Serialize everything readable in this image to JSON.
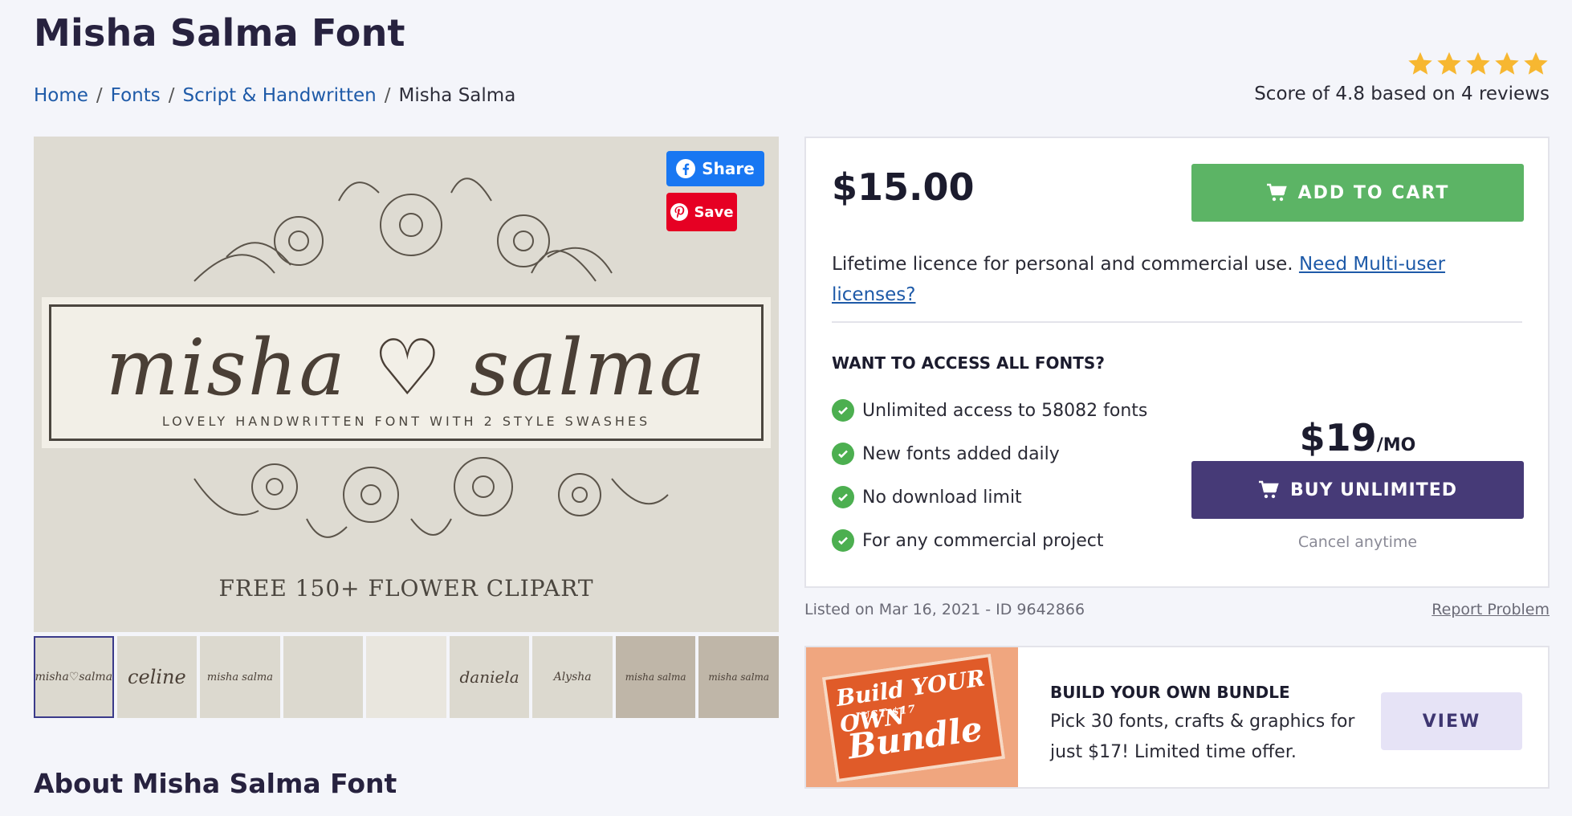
{
  "page": {
    "title": "Misha Salma Font"
  },
  "breadcrumb": [
    {
      "label": "Home"
    },
    {
      "label": "Fonts"
    },
    {
      "label": "Script & Handwritten"
    },
    {
      "label": "Misha Salma"
    }
  ],
  "rating": {
    "stars": 5,
    "text": "Score of 4.8 based on 4 reviews",
    "star_color": "#f7b731"
  },
  "preview": {
    "title_word": "misha ♡ salma",
    "tagline": "LOVELY HANDWRITTEN FONT WITH 2 STYLE SWASHES",
    "clipart_text": "FREE 150+ FLOWER CLIPART",
    "share_label": "Share",
    "save_label": "Save"
  },
  "thumbnails": [
    {
      "text": "misha♡salma"
    },
    {
      "text": "celine"
    },
    {
      "text": "misha salma"
    },
    {
      "text": ""
    },
    {
      "text": ""
    },
    {
      "text": "daniela"
    },
    {
      "text": "Alysha"
    },
    {
      "text": "misha salma"
    },
    {
      "text": "misha salma"
    }
  ],
  "purchase": {
    "price": "$15.00",
    "add_to_cart_label": "ADD TO CART",
    "licence_text": "Lifetime licence for personal and commercial use. ",
    "licence_link": "Need Multi-user licenses?",
    "access_title": "WANT TO ACCESS ALL FONTS?",
    "features": [
      {
        "label": "Unlimited access to 58082 fonts"
      },
      {
        "label": "New fonts added daily"
      },
      {
        "label": "No download limit"
      },
      {
        "label": "For any commercial project"
      }
    ],
    "unlimited_price": "$19",
    "unlimited_period": "/MO",
    "buy_unlimited_label": "BUY UNLIMITED",
    "cancel_note": "Cancel anytime"
  },
  "listing": {
    "listed_text": "Listed on Mar 16, 2021 - ID 9642866",
    "report_label": "Report Problem"
  },
  "bundle": {
    "badge_line1": "Build YOUR OWN",
    "badge_line2": "JUST $17",
    "badge_line3": "Bundle",
    "title": "BUILD YOUR OWN BUNDLE",
    "description": "Pick 30 fonts, crafts & graphics for just $17! Limited time offer.",
    "view_label": "VIEW"
  },
  "about": {
    "title": "About Misha Salma Font"
  },
  "colors": {
    "add_to_cart": "#5cb465",
    "buy_unlimited": "#463a77",
    "link": "#1e5aa8",
    "facebook": "#1877f2",
    "pinterest": "#e60023"
  }
}
